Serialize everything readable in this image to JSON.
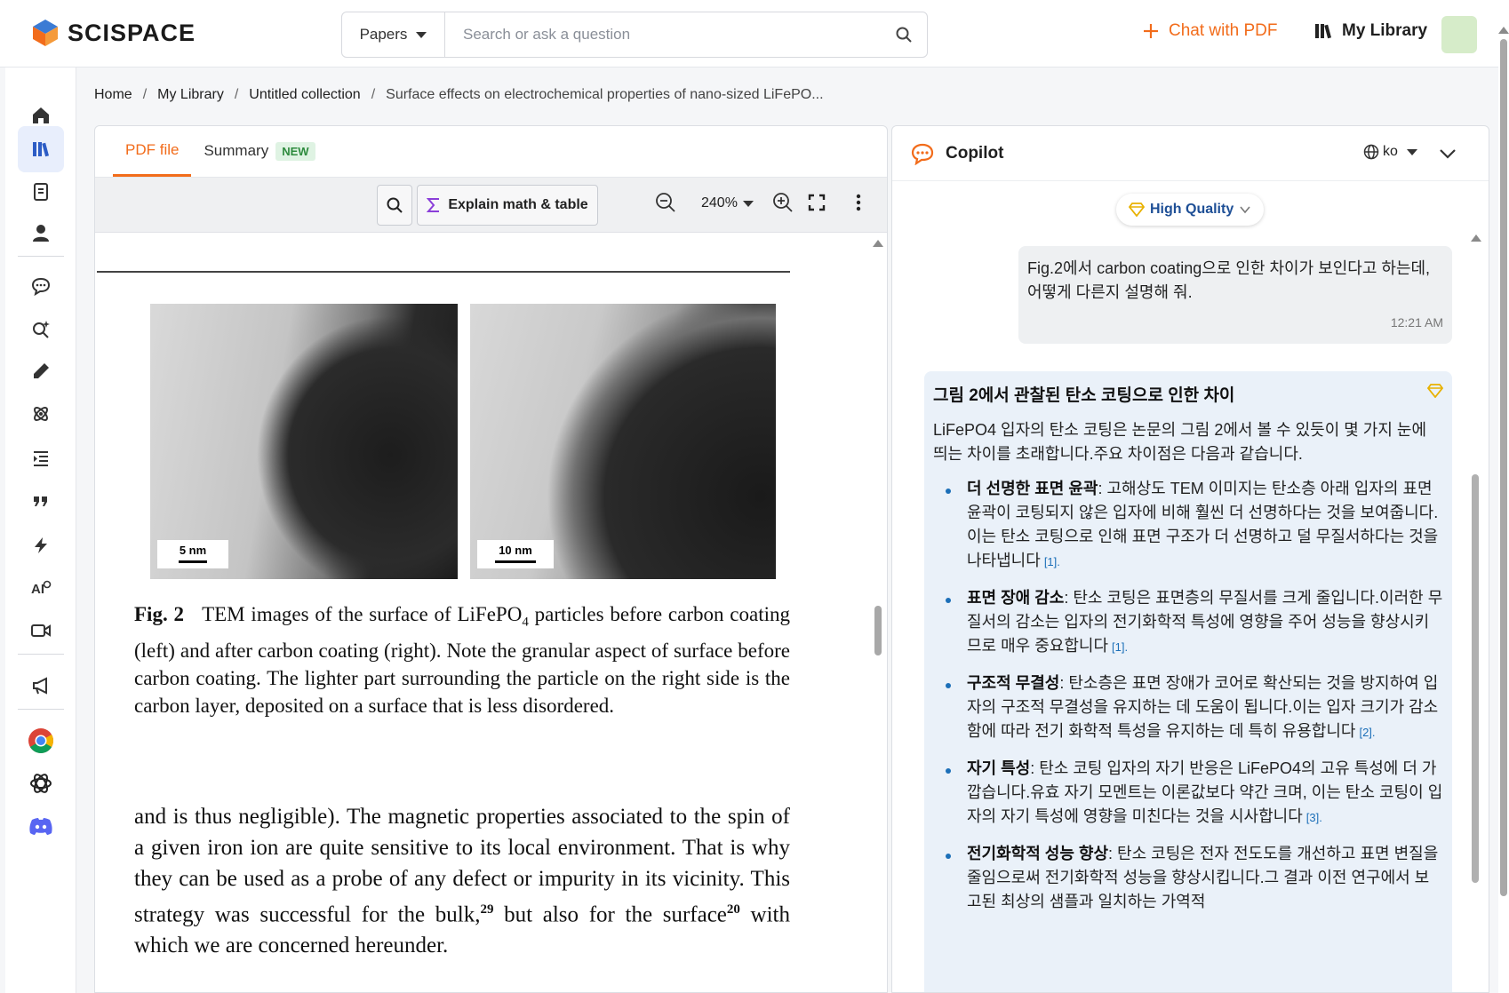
{
  "brand": {
    "name": "SCISPACE"
  },
  "search": {
    "scope": "Papers",
    "placeholder": "Search or ask a question"
  },
  "header": {
    "chat_pdf": "Chat with PDF",
    "my_library": "My Library"
  },
  "breadcrumb": [
    "Home",
    "My Library",
    "Untitled collection",
    "Surface effects on electrochemical properties of nano-sized LiFePO..."
  ],
  "pdf_tabs": {
    "pdf_file": "PDF file",
    "summary": "Summary",
    "summary_badge": "NEW"
  },
  "toolbar": {
    "explain": "Explain math & table",
    "zoom": "240%"
  },
  "figure": {
    "left_scale": "5 nm",
    "right_scale": "10 nm"
  },
  "caption": {
    "label": "Fig. 2",
    "text_before": "TEM images of the surface of LiFePO",
    "subscript": "4",
    "text_after": " particles before carbon coating (left) and after carbon coating (right). Note the granular aspect of surface before carbon coating. The lighter part surrounding the particle on the right side is the carbon layer, deposited on a surface that is less disordered."
  },
  "body": {
    "part1": "and is thus negligible). The magnetic properties associated to the spin of a given iron ion are quite sensitive to its local environment. That is why they can be used as a probe of any defect or impurity in its vicinity. This strategy was successful for the bulk,",
    "sup1": "29",
    "part2": " but also for the surface",
    "sup2": "20",
    "part3": " with which we are concerned hereunder."
  },
  "copilot": {
    "title": "Copilot",
    "lang": "ko",
    "quality": "High Quality",
    "user_message": "Fig.2에서 carbon coating으로 인한 차이가 보인다고 하는데, 어떻게 다른지 설명해 줘.",
    "user_time": "12:21 AM",
    "answer_title": "그림 2에서 관찰된 탄소 코팅으로 인한 차이",
    "answer_intro": "LiFePO4 입자의 탄소 코팅은 논문의 그림 2에서 볼 수 있듯이 몇 가지 눈에 띄는 차이를 초래합니다.주요 차이점은 다음과 같습니다.",
    "items": [
      {
        "heading": "더 선명한 표면 윤곽",
        "text": ": 고해상도 TEM 이미지는 탄소층 아래 입자의 표면 윤곽이 코팅되지 않은 입자에 비해 훨씬 더 선명하다는 것을 보여줍니다.이는 탄소 코팅으로 인해 표면 구조가 더 선명하고 덜 무질서하다는 것을 나타냅니다",
        "cite": "[1]."
      },
      {
        "heading": "표면 장애 감소",
        "text": ": 탄소 코팅은 표면층의 무질서를 크게 줄입니다.이러한 무질서의 감소는 입자의 전기화학적 특성에 영향을 주어 성능을 향상시키므로 매우 중요합니다",
        "cite": "[1]."
      },
      {
        "heading": "구조적 무결성",
        "text": ": 탄소층은 표면 장애가 코어로 확산되는 것을 방지하여 입자의 구조적 무결성을 유지하는 데 도움이 됩니다.이는 입자 크기가 감소함에 따라 전기 화학적 특성을 유지하는 데 특히 유용합니다",
        "cite": "[2]."
      },
      {
        "heading": "자기 특성",
        "text": ": 탄소 코팅 입자의 자기 반응은 LiFePO4의 고유 특성에 더 가깝습니다.유효 자기 모멘트는 이론값보다 약간 크며, 이는 탄소 코팅이 입자의 자기 특성에 영향을 미친다는 것을 시사합니다",
        "cite": "[3]."
      },
      {
        "heading": "전기화학적 성능 향상",
        "text": ": 탄소 코팅은 전자 전도도를 개선하고 표면 변질을 줄임으로써 전기화학적 성능을 향상시킵니다.그 결과 이전 연구에서 보고된 최상의 샘플과 일치하는 가역적",
        "cite": ""
      }
    ]
  }
}
